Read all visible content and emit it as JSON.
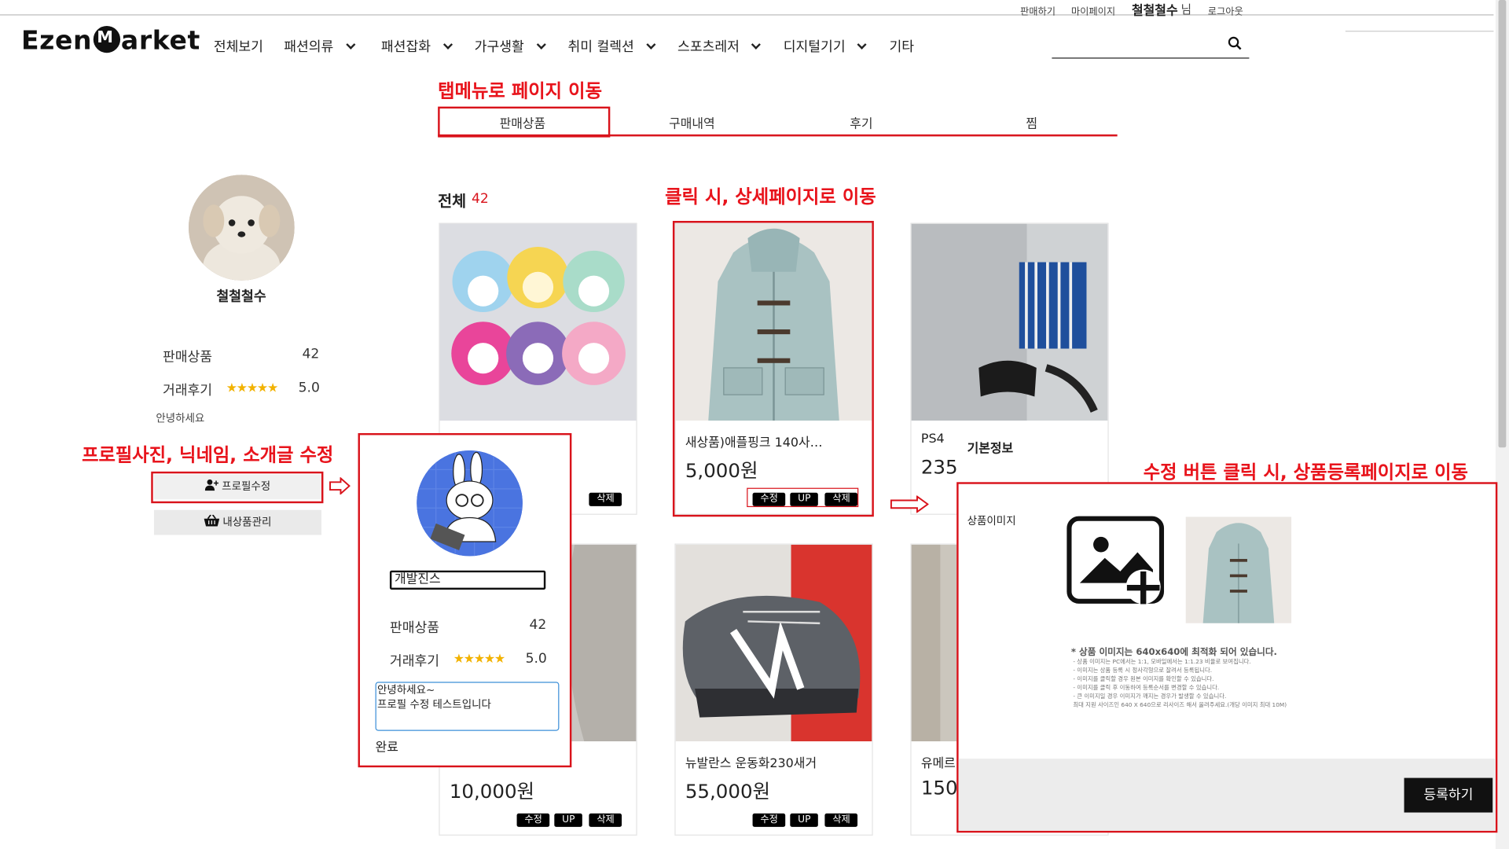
{
  "utility": {
    "sell": "판매하기",
    "mypage": "마이페이지",
    "user": "철철철수",
    "user_suffix": "님",
    "logout": "로그아웃"
  },
  "header": {
    "nav": [
      {
        "label": "전체보기",
        "dropdown": false
      },
      {
        "label": "패션의류",
        "dropdown": true
      },
      {
        "label": "패션잡화",
        "dropdown": true
      },
      {
        "label": "가구생활",
        "dropdown": true
      },
      {
        "label": "취미 컬렉션",
        "dropdown": true
      },
      {
        "label": "스포츠레저",
        "dropdown": true
      },
      {
        "label": "디지털기기",
        "dropdown": true
      },
      {
        "label": "기타",
        "dropdown": false
      }
    ],
    "search_icon": "search-icon"
  },
  "annotations": {
    "tabs_note": "탭메뉴로 페이지 이동",
    "detail_note": "클릭 시, 상세페이지로 이동",
    "profile_note": "프로필사진, 닉네임, 소개글 수정",
    "edit_note": "수정 버튼 클릭 시, 상품등록페이지로 이동"
  },
  "tabs": [
    "판매상품",
    "구매내역",
    "후기",
    "찜"
  ],
  "profile": {
    "name": "철철철수",
    "sales_label": "판매상품",
    "sales_count": "42",
    "review_label": "거래후기",
    "stars": "★★★★★",
    "rating": "5.0",
    "intro": "안녕하세요",
    "edit_button": "프로필수정",
    "manage_button": "내상품관리"
  },
  "profile_edit": {
    "nickname": "개발진스",
    "sales_label": "판매상품",
    "sales_count": "42",
    "review_label": "거래후기",
    "stars": "★★★★★",
    "rating": "5.0",
    "intro_text": "안녕하세요~\n프로필 수정 테스트입니다",
    "done": "완료"
  },
  "products": {
    "count_label": "전체",
    "count": "42",
    "buttons": {
      "edit": "수정",
      "up": "UP",
      "delete": "삭제"
    },
    "items": [
      {
        "title": "",
        "price": ""
      },
      {
        "title": "새상품)애플핑크 140사…",
        "price": "5,000원"
      },
      {
        "title": "PS4 ",
        "price": "235"
      },
      {
        "title": "",
        "price": "10,000원"
      },
      {
        "title": "뉴발란스 운동화230새거",
        "price": "55,000원"
      },
      {
        "title": "유메르",
        "price": "150,"
      }
    ]
  },
  "register": {
    "section": "기본정보",
    "image_label": "상품이미지",
    "notice_title": "* 상품 이미지는 640x640에 최적화 되어 있습니다.",
    "notice_lines": [
      "- 상품 이미지는 PC에서는 1:1, 모바일에서는 1:1.23 비율로 보여집니다.",
      "- 이미지는 상품 등록 시 정사각형으로 잘려서 등록됩니다.",
      "- 이미지를 클릭할 경우 원본 이미지를 확인할 수 있습니다.",
      "- 이미지를 클릭 후 이동하여 등록순서를 변경할 수 있습니다.",
      "- 큰 이미지일 경우 이미지가 깨지는 경우가 발생할 수 있습니다.",
      "최대 지원 사이즈인 640 X 640으로 리사이즈 해서 올려주세요.(개당 이미지 최대 10M)"
    ],
    "submit": "등록하기"
  }
}
